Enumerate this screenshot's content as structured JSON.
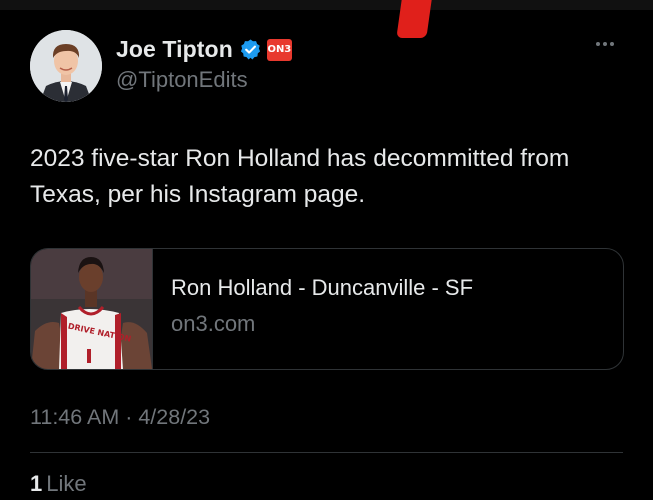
{
  "author": {
    "name": "Joe Tipton",
    "handle": "@TiptonEdits",
    "badge_text": "ON3"
  },
  "tweet": {
    "text": "2023 five-star Ron Holland has decommitted from Texas, per his Instagram page.",
    "timestamp": "11:46 AM · 4/28/23"
  },
  "link_card": {
    "title": "Ron Holland - Duncanville - SF",
    "domain": "on3.com",
    "jersey_text": "DRIVE NATION"
  },
  "engagement": {
    "like_count": "1",
    "like_label": "Like"
  },
  "colors": {
    "background": "#000000",
    "text_primary": "#e7e9ea",
    "text_secondary": "#71767b",
    "verified_blue": "#1d9bf0",
    "on3_red": "#e8392e",
    "border": "#2f3336"
  },
  "icons": {
    "verified": "verified-badge-icon",
    "more": "more-options-icon",
    "on3": "on3-logo-icon"
  }
}
